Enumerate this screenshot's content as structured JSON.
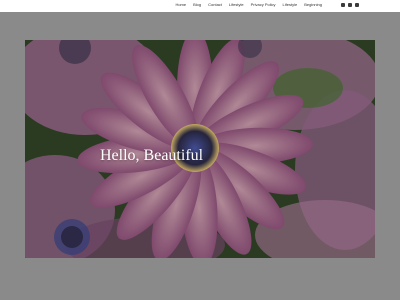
{
  "nav": {
    "items": [
      {
        "label": "Home"
      },
      {
        "label": "Blog"
      },
      {
        "label": "Contact"
      },
      {
        "label": "Lifestyle"
      },
      {
        "label": "Privacy Policy"
      },
      {
        "label": "Lifestyle"
      },
      {
        "label": "Beginning"
      }
    ]
  },
  "social": {
    "icons": [
      "facebook-icon",
      "instagram-icon",
      "youtube-icon"
    ]
  },
  "hero": {
    "title": "Hello, Beautiful"
  },
  "colors": {
    "page_background": "#8a8a8a",
    "header_background": "#ffffff",
    "petal": "#b36a96",
    "flower_center": "#2f2c4a",
    "leaf": "#466b30"
  }
}
